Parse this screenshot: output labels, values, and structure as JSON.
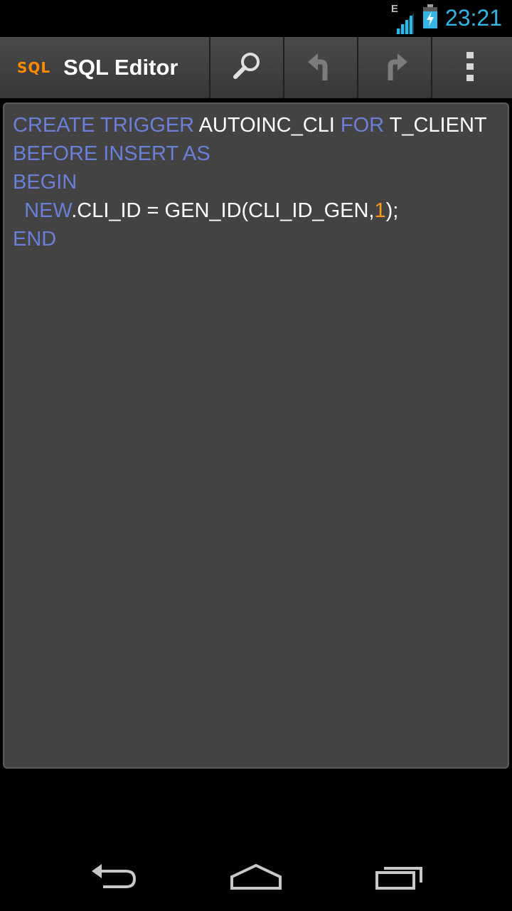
{
  "status_bar": {
    "network_type": "E",
    "time": "23:21",
    "icons": [
      "signal-icon",
      "battery-charging-icon"
    ]
  },
  "action_bar": {
    "logo_text": "SQL",
    "title": "SQL Editor",
    "actions": [
      {
        "name": "search",
        "icon": "search-icon"
      },
      {
        "name": "undo",
        "icon": "undo-icon"
      },
      {
        "name": "redo",
        "icon": "redo-icon"
      },
      {
        "name": "overflow-menu",
        "icon": "more-vert-icon"
      }
    ]
  },
  "editor": {
    "colors": {
      "keyword": "#6b7fd6",
      "number": "#ff9b1a",
      "plain": "#ffffff",
      "background": "#434343"
    },
    "lines": [
      [
        {
          "t": "CREATE TRIGGER ",
          "c": "kw"
        },
        {
          "t": "AUTOINC_CLI ",
          "c": "plain"
        },
        {
          "t": "FOR ",
          "c": "kw"
        },
        {
          "t": "T_CLIENT",
          "c": "plain"
        }
      ],
      [
        {
          "t": "BEFORE INSERT AS",
          "c": "kw"
        }
      ],
      [
        {
          "t": "BEGIN",
          "c": "kw"
        }
      ],
      [
        {
          "t": "  ",
          "c": "plain"
        },
        {
          "t": "NEW",
          "c": "kw"
        },
        {
          "t": ".CLI_ID = GEN_ID(CLI_ID_GEN,",
          "c": "plain"
        },
        {
          "t": "1",
          "c": "num"
        },
        {
          "t": ");",
          "c": "plain"
        }
      ],
      [
        {
          "t": "END",
          "c": "kw"
        }
      ]
    ]
  },
  "nav_bar": {
    "buttons": [
      "back-icon",
      "home-icon",
      "recent-apps-icon"
    ]
  }
}
